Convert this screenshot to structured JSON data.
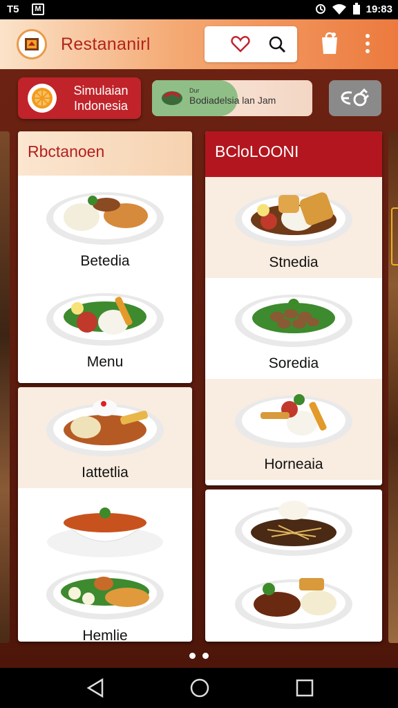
{
  "status": {
    "left_text": "T5",
    "mini_icon": "M",
    "time": "19:83"
  },
  "appbar": {
    "title": "Restananirl"
  },
  "chips": {
    "simulation_label": "Simulaian Indonesia",
    "toggle_small": "Dur",
    "toggle_label": "Bodiadelsia lan Jam",
    "location_label": "EG"
  },
  "cards": {
    "left_top_header": "Rbctanoen",
    "left_top_items": [
      "Betedia",
      "Menu"
    ],
    "left_bottom_items": [
      "Iattetlia",
      "Hemlie"
    ],
    "right_top_header": "BCloLOONI",
    "right_top_items": [
      "Stnedia",
      "Soredia",
      "Horneaia"
    ],
    "right_bottom_items": [
      "",
      ""
    ]
  },
  "colors": {
    "brand_red": "#b3161e",
    "accent_orange": "#ec7a3e",
    "toggle_green": "#8fbf86"
  },
  "icons": [
    "logo-icon",
    "heart-icon",
    "search-icon",
    "shopping-bag-icon",
    "more-vert-icon",
    "orange-slice-icon",
    "map-pin-icon",
    "location-refresh-icon",
    "back-icon",
    "home-icon",
    "recent-apps-icon"
  ]
}
